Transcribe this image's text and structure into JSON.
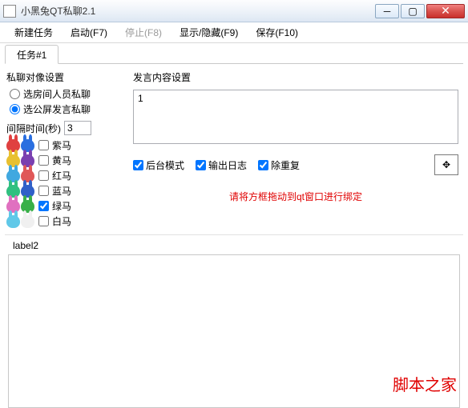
{
  "window": {
    "title": "小黑兔QT私聊2.1"
  },
  "menu": {
    "new_task": "新建任务",
    "start": "启动(F7)",
    "stop": "停止(F8)",
    "toggle": "显示/隐藏(F9)",
    "save": "保存(F10)"
  },
  "tab": {
    "label": "任务#1"
  },
  "left": {
    "group_title": "私聊对像设置",
    "radio_room": "选房间人员私聊",
    "radio_screen": "选公屏发言私聊",
    "interval_label": "间隔时间(秒)",
    "interval_value": "3",
    "colors": [
      {
        "b1": "#e04040",
        "b2": "#2a6fe0",
        "label": "紫马"
      },
      {
        "b1": "#e8c030",
        "b2": "#7a40b0",
        "label": "黄马"
      },
      {
        "b1": "#40a8e0",
        "b2": "#e05858",
        "label": "红马"
      },
      {
        "b1": "#30c080",
        "b2": "#3060c8",
        "label": "蓝马"
      },
      {
        "b1": "#e070c0",
        "b2": "#38b048",
        "label": "绿马"
      },
      {
        "b1": "#60c8e8",
        "b2": "#f0f0f0",
        "label": "白马"
      }
    ],
    "checked_index": 4
  },
  "right": {
    "group_title": "发言内容设置",
    "content": "1",
    "opt_backend": "后台模式",
    "opt_log": "输出日志",
    "opt_dedup": "除重复",
    "move_glyph": "✥",
    "hint": "请将方框拖动到qt窗口进行绑定"
  },
  "label2": "label2",
  "watermark": {
    "text": "脚本之家",
    "url": "www.jb51.net"
  }
}
